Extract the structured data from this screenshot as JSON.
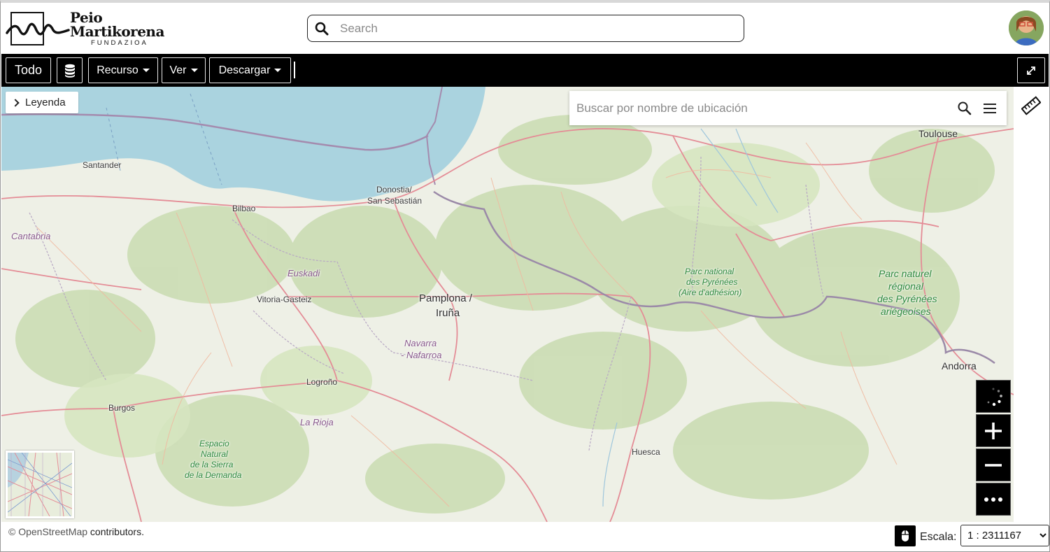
{
  "header": {
    "logo": {
      "name_line1": "Peio",
      "name_line2": "Martikorena",
      "subtitle": "FUNDAZIOA"
    },
    "search": {
      "placeholder": "Search",
      "value": ""
    },
    "avatar_icon": "user-avatar"
  },
  "toolbar": {
    "all_label": "Todo",
    "database_icon": "database-icon",
    "resource_label": "Recurso",
    "view_label": "Ver",
    "download_label": "Descargar",
    "fullscreen_icon": "expand-icon"
  },
  "map": {
    "legend_label": "Leyenda",
    "location_search": {
      "placeholder": "Buscar por nombre de ubicación",
      "value": ""
    },
    "labels": {
      "santander": "Santander",
      "bilbao": "Bilbao",
      "cantabria": "Cantabria",
      "donostia1": "Donostia/",
      "donostia2": "San Sebastián",
      "euskadi": "Euskadi",
      "vitoria": "Vitoria-Gasteiz",
      "pamplona1": "Pamplona /",
      "pamplona2": "Iruña",
      "navarra1": "Navarra",
      "navarra2": "- Nafarroa",
      "logrono": "Logroño",
      "burgos": "Burgos",
      "rioja": "La Rioja",
      "demanda1": "Espacio",
      "demanda2": "Natural",
      "demanda3": "de la Sierra",
      "demanda4": "de la Demanda",
      "pyr1": "Parc national",
      "pyr2": "des Pyrénées",
      "pyr3": "(Aire d'adhésion)",
      "ariege1": "Parc naturel",
      "ariege2": "régional",
      "ariege3": "des Pyrénées",
      "ariege4": "ariégeoises",
      "toulouse": "Toulouse",
      "andorra": "Andorra",
      "huesca": "Huesca"
    }
  },
  "footer": {
    "attribution_link": "© OpenStreetMap",
    "attribution_rest": " contributors.",
    "scale_label": "Escala:",
    "scale_value": "1 : 2311167",
    "scale_options": [
      "1 : 2311167"
    ]
  },
  "colors": {
    "sea": "#aad3df",
    "land": "#eef0e6",
    "forest": "#c8dcae",
    "border": "#9a8da6",
    "road_major": "#e8919b",
    "toolbar_bg": "#000000"
  }
}
